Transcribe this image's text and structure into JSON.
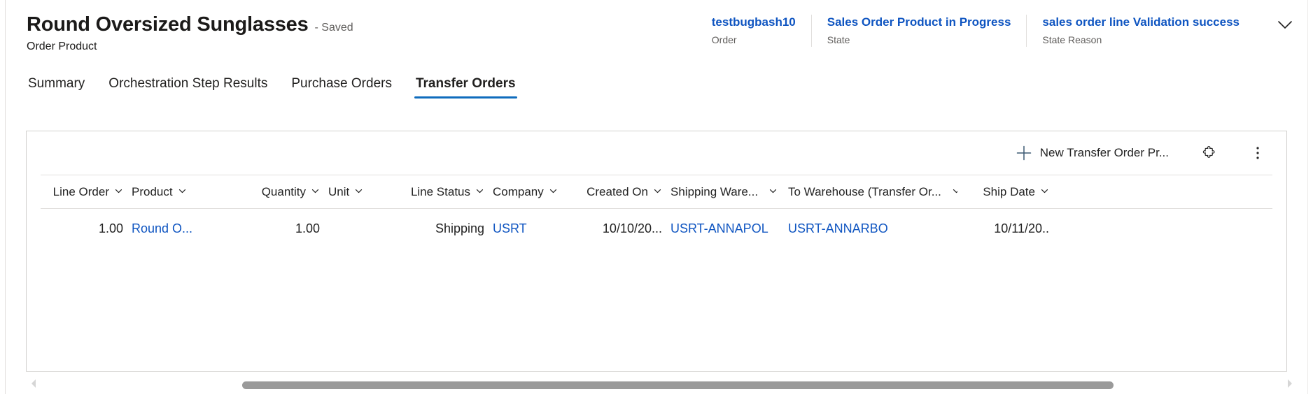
{
  "header": {
    "record_title": "Round Oversized Sunglasses",
    "saved_status": "- Saved",
    "entity_subtitle": "Order Product",
    "fields": [
      {
        "value": "testbugbash10",
        "label": "Order",
        "name": "order"
      },
      {
        "value": "Sales Order Product in Progress",
        "label": "State",
        "name": "state"
      },
      {
        "value": "sales order line Validation success",
        "label": "State Reason",
        "name": "state-reason"
      }
    ],
    "expand_icon": "chevron-down-icon"
  },
  "tabs": [
    {
      "label": "Summary",
      "selected": false
    },
    {
      "label": "Orchestration Step Results",
      "selected": false
    },
    {
      "label": "Purchase Orders",
      "selected": false
    },
    {
      "label": "Transfer Orders",
      "selected": true
    }
  ],
  "grid": {
    "toolbar": {
      "new_label": "New Transfer Order Pr...",
      "new_icon": "plus-icon",
      "flow_icon": "puzzle-piece-icon",
      "more_icon": "more-vertical-icon"
    },
    "columns": [
      {
        "label": "Line Order",
        "key": "c-lineorder",
        "align": "num",
        "name": "column-line-order"
      },
      {
        "label": "Product",
        "key": "c-product",
        "align": "text",
        "name": "column-product"
      },
      {
        "label": "Quantity",
        "key": "c-quantity",
        "align": "num",
        "name": "column-quantity"
      },
      {
        "label": "Unit",
        "key": "c-unit",
        "align": "text",
        "name": "column-unit"
      },
      {
        "label": "Line Status",
        "key": "c-linestatus",
        "align": "num",
        "name": "column-line-status"
      },
      {
        "label": "Company",
        "key": "c-company",
        "align": "text",
        "name": "column-company"
      },
      {
        "label": "Created On",
        "key": "c-createdon",
        "align": "num",
        "name": "column-created-on"
      },
      {
        "label": "Shipping Ware...",
        "key": "c-shipware",
        "align": "text",
        "name": "column-shipping-warehouse"
      },
      {
        "label": "To Warehouse (Transfer Or...",
        "key": "c-towarehouse",
        "align": "text",
        "name": "column-to-warehouse"
      },
      {
        "label": "Ship Date",
        "key": "c-shipdate",
        "align": "num",
        "name": "column-ship-date"
      }
    ],
    "rows": [
      {
        "line_order": "1.00",
        "product": "Round O...",
        "quantity": "1.00",
        "unit": "",
        "line_status": "Shipping",
        "company": "USRT",
        "created_on": "10/10/20...",
        "shipping_warehouse": "USRT-ANNAPOL",
        "to_warehouse": "USRT-ANNARBO",
        "ship_date": "10/11/20.."
      }
    ]
  },
  "scrollbar": {
    "left_arrow_icon": "caret-left-icon",
    "right_arrow_icon": "caret-right-icon"
  },
  "colors": {
    "link": "#0f55c1",
    "tab_accent": "#0f6cbd",
    "border": "#e1dfdd",
    "panel_border": "#d2d0ce",
    "scroll_thumb": "#9a9a9a"
  }
}
